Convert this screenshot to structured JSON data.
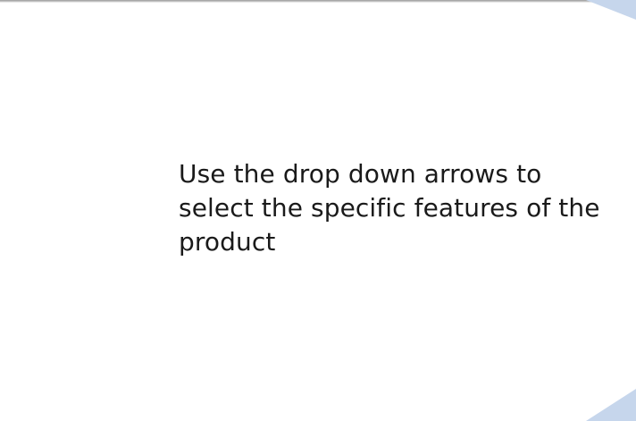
{
  "message": {
    "text": "Use the drop down arrows to select the specific features of the product"
  },
  "colors": {
    "background": "#ffffff",
    "accent_triangle": "#c6d6ec",
    "text": "#1a1a1a"
  }
}
